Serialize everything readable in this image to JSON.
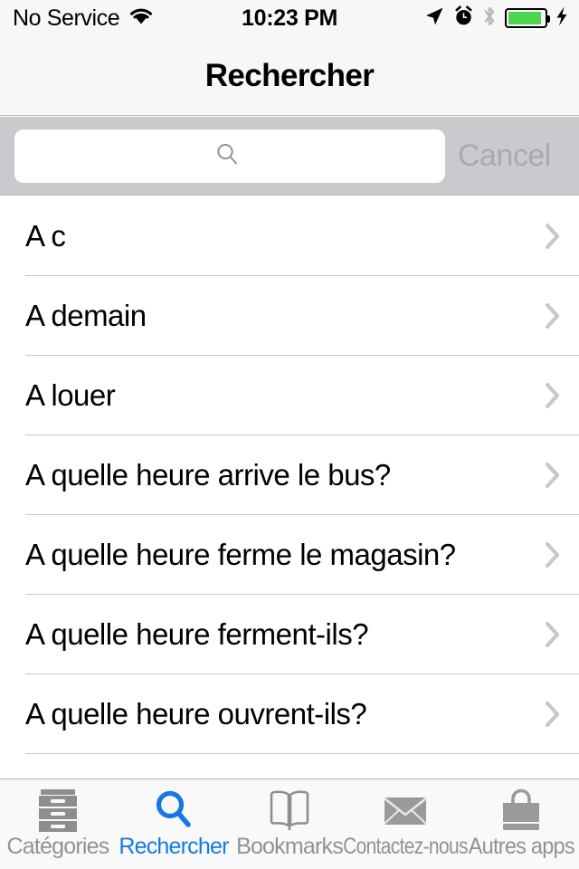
{
  "status_bar": {
    "carrier": "No Service",
    "wifi_icon": "wifi-icon",
    "time": "10:23 PM",
    "location_icon": "location-arrow-icon",
    "alarm_icon": "alarm-clock-icon",
    "bluetooth_icon": "bluetooth-icon",
    "battery_icon": "battery-icon",
    "battery_level_percent": 92,
    "battery_color": "#4cd551",
    "charging_icon": "lightning-bolt-icon"
  },
  "nav_bar": {
    "title": "Rechercher"
  },
  "search": {
    "value": "",
    "placeholder": "",
    "icon": "search-icon",
    "cancel_label": "Cancel",
    "cancel_enabled": false,
    "bar_color": "#c9c9ce"
  },
  "list": {
    "accessory_icon": "chevron-right-icon",
    "rows": [
      {
        "label": "A c"
      },
      {
        "label": "A demain"
      },
      {
        "label": "A louer"
      },
      {
        "label": "A quelle heure arrive le bus?"
      },
      {
        "label": "A quelle heure ferme le magasin?"
      },
      {
        "label": "A quelle heure ferment-ils?"
      },
      {
        "label": "A quelle heure ouvrent-ils?"
      }
    ]
  },
  "tab_bar": {
    "selected_index": 1,
    "selected_color": "#1479e4",
    "inactive_color": "#929292",
    "tabs": [
      {
        "label": "Catégories",
        "icon": "file-cabinet-icon"
      },
      {
        "label": "Rechercher",
        "icon": "search-icon"
      },
      {
        "label": "Bookmarks",
        "icon": "open-book-icon"
      },
      {
        "label": "Contactez-nous",
        "icon": "envelope-icon"
      },
      {
        "label": "Autres apps",
        "icon": "shopping-bag-icon"
      }
    ]
  }
}
